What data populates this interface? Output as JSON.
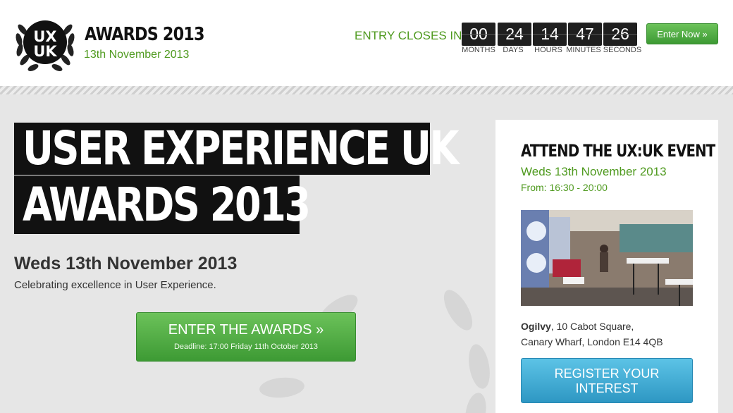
{
  "header": {
    "logo_text": "UX UK",
    "logo_title": "AWARDS 2013",
    "logo_date": "13th November 2013",
    "entry_label": "ENTRY CLOSES IN:",
    "countdown": [
      {
        "value": "00",
        "label": "MONTHS"
      },
      {
        "value": "24",
        "label": "DAYS"
      },
      {
        "value": "14",
        "label": "HOURS"
      },
      {
        "value": "47",
        "label": "MINUTES"
      },
      {
        "value": "26",
        "label": "SECONDS"
      }
    ],
    "enter_now": "Enter Now »"
  },
  "hero": {
    "title_line1": "USER EXPERIENCE UK",
    "title_line2": "AWARDS 2013",
    "date": "Weds 13th November 2013",
    "subtitle": "Celebrating excellence in User Experience.",
    "button_main": "ENTER THE AWARDS »",
    "button_sub": "Deadline: 17:00 Friday 11th October 2013"
  },
  "panel": {
    "title": "ATTEND THE UX:UK EVENT",
    "date": "Weds 13th November 2013",
    "time": "From: 16:30 - 20:00",
    "venue": "Ogilvy",
    "address_line1": ", 10 Cabot Square,",
    "address_line2": "Canary Wharf, London E14 4QB",
    "register_line1": "REGISTER YOUR",
    "register_line2": "INTEREST"
  },
  "colors": {
    "accent_green": "#4f9a1f",
    "button_green": "#4caf3f",
    "button_blue": "#3aa6d2",
    "dark": "#111111",
    "page_bg": "#e6e6e6"
  }
}
